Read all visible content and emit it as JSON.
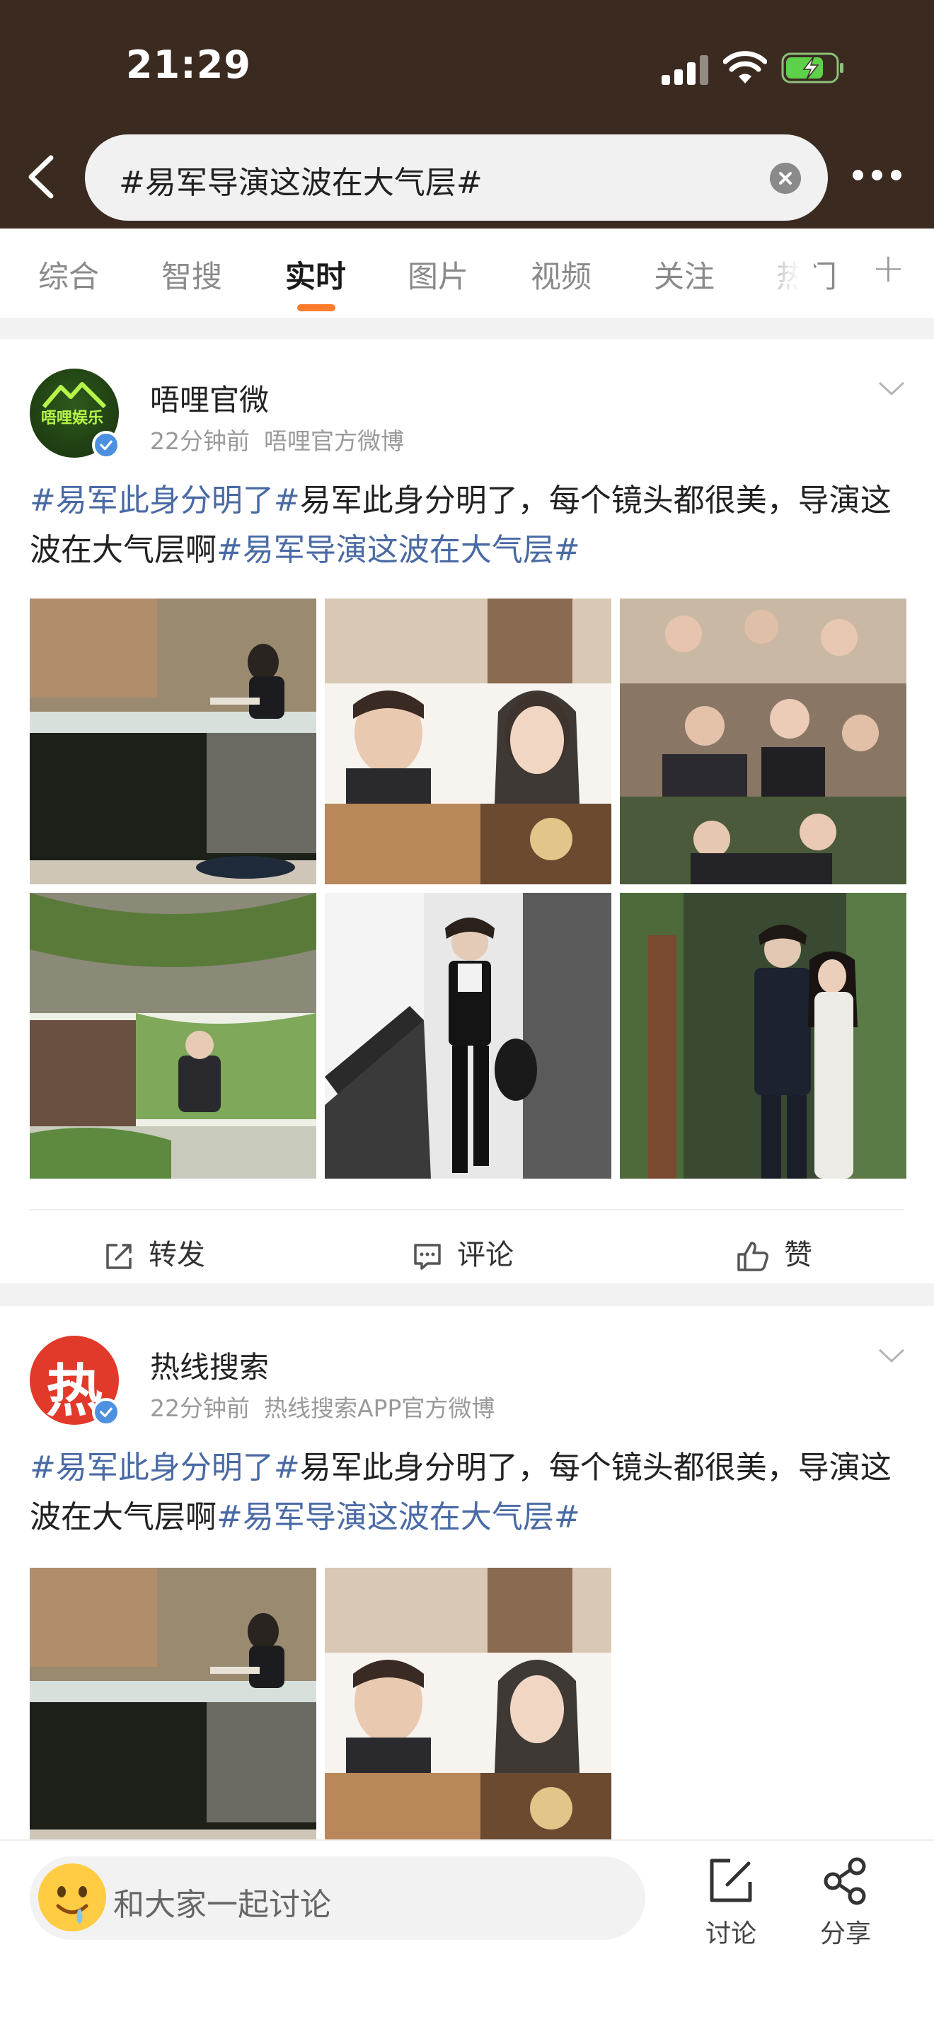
{
  "status_bar": {
    "time": "21:29"
  },
  "search": {
    "query": "#易军导演这波在大气层#"
  },
  "tabs": [
    {
      "label": "综合",
      "active": false
    },
    {
      "label": "智搜",
      "active": false
    },
    {
      "label": "实时",
      "active": true
    },
    {
      "label": "图片",
      "active": false
    },
    {
      "label": "视频",
      "active": false
    },
    {
      "label": "关注",
      "active": false
    },
    {
      "label": "热门",
      "active": false
    }
  ],
  "accent_color": "#ff7d2a",
  "hashtag_color": "#4a6aa5",
  "posts": [
    {
      "user": "唔哩官微",
      "avatar_text": "唔哩娱乐",
      "time": "22分钟前",
      "source": "唔哩官方微博",
      "tag1": "#易军此身分明了#",
      "body": "易军此身分明了，每个镜头都很美，导演这波在大气层啊",
      "tag2": "#易军导演这波在大气层#",
      "photo_count": 6,
      "actions": {
        "repost": "转发",
        "comment": "评论",
        "like": "赞"
      }
    },
    {
      "user": "热线搜索",
      "avatar_text": "热",
      "time": "22分钟前",
      "source": "热线搜索APP官方微博",
      "tag1": "#易军此身分明了#",
      "body": "易军此身分明了，每个镜头都很美，导演这波在大气层啊",
      "tag2": "#易军导演这波在大气层#",
      "photo_count": 2
    }
  ],
  "bottom_bar": {
    "placeholder": "和大家一起讨论",
    "discuss": "讨论",
    "share": "分享"
  }
}
